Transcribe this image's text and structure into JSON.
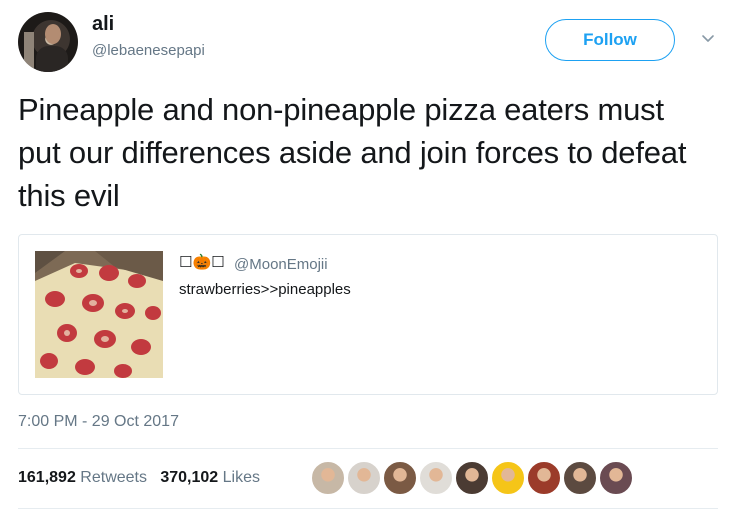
{
  "author": {
    "display_name": "ali",
    "handle": "@lebaenesepapi"
  },
  "follow_label": "Follow",
  "tweet": {
    "text": "Pineapple and non-pineapple pizza eaters must put our differences aside and join forces to defeat this evil",
    "timestamp": "7:00 PM - 29 Oct 2017"
  },
  "quoted": {
    "name": "☐🎃☐",
    "handle": "@MoonEmojii",
    "text": "strawberries>>pineapples"
  },
  "stats": {
    "retweets_count": "161,892",
    "retweets_label": "Retweets",
    "likes_count": "370,102",
    "likes_label": "Likes"
  },
  "likers": [
    {
      "icon": "liker-avatar-1",
      "color": "#c7b8a6"
    },
    {
      "icon": "liker-avatar-2",
      "color": "#d7d2cc"
    },
    {
      "icon": "liker-avatar-3",
      "color": "#7b5a44"
    },
    {
      "icon": "liker-avatar-4",
      "color": "#e0ddd8"
    },
    {
      "icon": "liker-avatar-5",
      "color": "#4b3b33"
    },
    {
      "icon": "liker-avatar-6",
      "color": "#f5c518"
    },
    {
      "icon": "liker-avatar-7",
      "color": "#9b3b2a"
    },
    {
      "icon": "liker-avatar-8",
      "color": "#5c4a40"
    },
    {
      "icon": "liker-avatar-9",
      "color": "#6a4b52"
    }
  ],
  "colors": {
    "accent": "#1da1f2",
    "secondary_text": "#657786",
    "primary_text": "#14171a",
    "border": "#e1e8ed"
  }
}
